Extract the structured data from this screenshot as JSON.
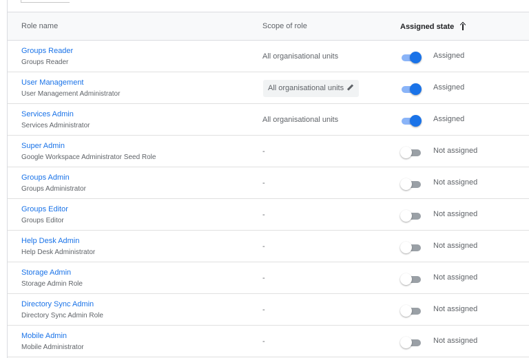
{
  "table": {
    "columns": {
      "role_name": "Role name",
      "scope": "Scope of role",
      "assigned_state": "Assigned state"
    },
    "sort_icon": "arrow-upward-icon",
    "accent_color": "#1a73e8",
    "rows": [
      {
        "name": "Groups Reader",
        "description": "Groups Reader",
        "scope": "All organisational units",
        "scope_editable": false,
        "assigned": true,
        "state": "Assigned"
      },
      {
        "name": "User Management",
        "description": "User Management Administrator",
        "scope": "All organisational units",
        "scope_editable": true,
        "assigned": true,
        "state": "Assigned"
      },
      {
        "name": "Services Admin",
        "description": "Services Administrator",
        "scope": "All organisational units",
        "scope_editable": false,
        "assigned": true,
        "state": "Assigned"
      },
      {
        "name": "Super Admin",
        "description": "Google Workspace Administrator Seed Role",
        "scope": "-",
        "scope_editable": false,
        "assigned": false,
        "state": "Not assigned"
      },
      {
        "name": "Groups Admin",
        "description": "Groups Administrator",
        "scope": "-",
        "scope_editable": false,
        "assigned": false,
        "state": "Not assigned"
      },
      {
        "name": "Groups Editor",
        "description": "Groups Editor",
        "scope": "-",
        "scope_editable": false,
        "assigned": false,
        "state": "Not assigned"
      },
      {
        "name": "Help Desk Admin",
        "description": "Help Desk Administrator",
        "scope": "-",
        "scope_editable": false,
        "assigned": false,
        "state": "Not assigned"
      },
      {
        "name": "Storage Admin",
        "description": "Storage Admin Role",
        "scope": "-",
        "scope_editable": false,
        "assigned": false,
        "state": "Not assigned"
      },
      {
        "name": "Directory Sync Admin",
        "description": "Directory Sync Admin Role",
        "scope": "-",
        "scope_editable": false,
        "assigned": false,
        "state": "Not assigned"
      },
      {
        "name": "Mobile Admin",
        "description": "Mobile Administrator",
        "scope": "-",
        "scope_editable": false,
        "assigned": false,
        "state": "Not assigned"
      }
    ]
  }
}
